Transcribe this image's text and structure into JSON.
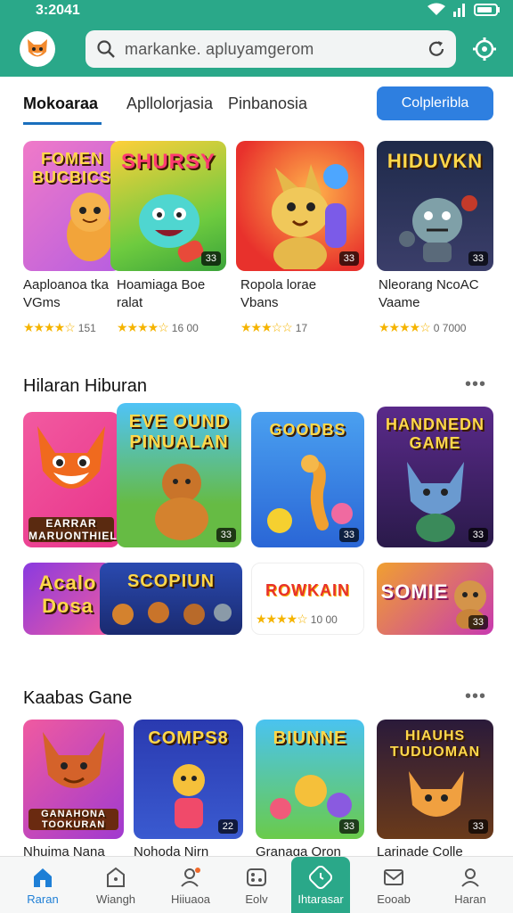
{
  "status": {
    "time": "3:2041"
  },
  "search": {
    "text": "markanke. apluyamgerom"
  },
  "tabs": [
    {
      "label": "Mokoaraa"
    },
    {
      "label": "Apllolorjasia"
    },
    {
      "label": "Pinbanosia"
    }
  ],
  "cta": {
    "label": "Colpleribla"
  },
  "top_row": [
    {
      "art": "FOMEN\nBUCBICSE",
      "badge": "33",
      "name1": "Aaploanoa tka",
      "name2": "VGms",
      "stars": "★★★★☆",
      "count": "151"
    },
    {
      "art": "SHURSY",
      "badge": "33",
      "name1": "Hoamiaga Boe",
      "name2": "ralat",
      "stars": "★★★★☆",
      "count": "16 00"
    },
    {
      "art": "",
      "badge": "33",
      "name1": "Ropola lorae",
      "name2": "Vbans",
      "stars": "★★★☆☆",
      "count": "17"
    },
    {
      "art": "HIDUVKN",
      "badge": "33",
      "name1": "Nleorang NcoAC",
      "name2": "Vaame",
      "stars": "★★★★☆",
      "count": "0 7000"
    }
  ],
  "section1": {
    "title": "Hilaran Hiburan",
    "more": "•••"
  },
  "grid_row1": [
    {
      "art": "EARRAR\nMARUONTHIEL",
      "badge": ""
    },
    {
      "art": "EVE OUND\nPINUALAN",
      "badge": "33"
    },
    {
      "art": "GOODBS",
      "badge": "33"
    },
    {
      "art": "HANDNEDN\nGAME",
      "badge": "33"
    }
  ],
  "grid_row2": [
    {
      "art": "Acalo\nDosa",
      "badge": ""
    },
    {
      "art": "SCOPIUN",
      "badge": ""
    },
    {
      "art": "ROWKAIN",
      "badge": "",
      "stars": "★★★★☆",
      "count": "10 00"
    },
    {
      "art": "SOMIE",
      "badge": "33"
    }
  ],
  "section2": {
    "title": "Kaabas Gane",
    "more": "•••"
  },
  "bottom_row": [
    {
      "art": "GANAHONA\nTOOKURAN",
      "badge": "",
      "name": "Nhuima Nana"
    },
    {
      "art": "COMPS8",
      "badge": "22",
      "name": "Nohoda Nirn"
    },
    {
      "art": "BIUNNE",
      "badge": "33",
      "name": "Granaga Oron"
    },
    {
      "art": "HIAUHS\nTUDUOMAN",
      "badge": "33",
      "name": "Larinade Colle"
    }
  ],
  "nav": [
    {
      "label": "Raran",
      "icon": "home-icon"
    },
    {
      "label": "Wiangh",
      "icon": "bag-icon"
    },
    {
      "label": "Hiiuaoa",
      "icon": "person-icon"
    },
    {
      "label": "Eolv",
      "icon": "game-icon"
    },
    {
      "label": "Ihtarasar",
      "icon": "clock-icon"
    },
    {
      "label": "Eooab",
      "icon": "mail-icon"
    },
    {
      "label": "Haran",
      "icon": "profile-icon"
    }
  ],
  "colors": {
    "header": "#2aa889",
    "accent": "#2e7fe0",
    "star": "#f5b400"
  }
}
